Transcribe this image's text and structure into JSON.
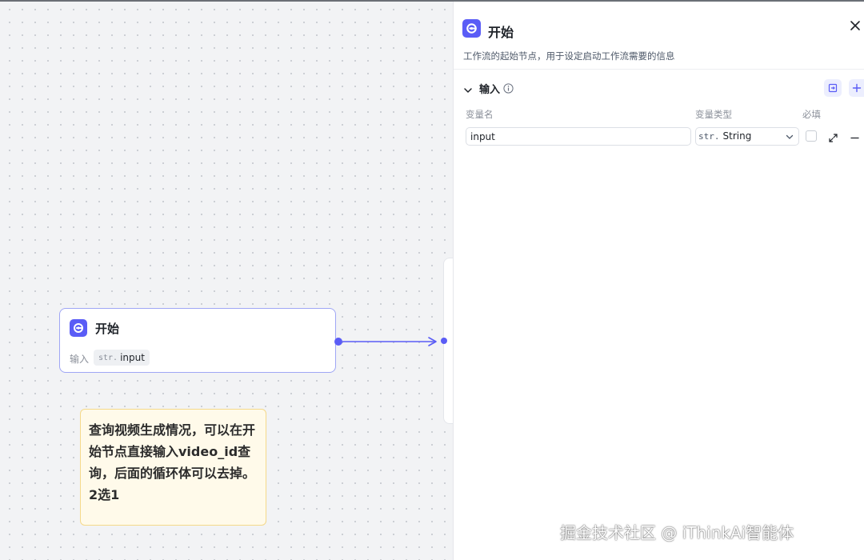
{
  "canvas": {
    "start_node": {
      "title": "开始",
      "input_label": "输入",
      "input_var": {
        "type": "str.",
        "name": "input"
      }
    },
    "note": {
      "text": "查询视频生成情况，可以在开始节点直接输入video_id查询，后面的循环体可以去掉。2选1"
    }
  },
  "panel": {
    "title": "开始",
    "description": "工作流的起始节点，用于设定启动工作流需要的信息",
    "section": {
      "title": "输入",
      "columns": {
        "name": "变量名",
        "type": "变量类型",
        "required": "必填"
      },
      "rows": [
        {
          "name": "input",
          "type_prefix": "str.",
          "type": "String",
          "required": false
        }
      ]
    }
  },
  "watermark": "掘金技术社区 @ iThinkAi智能体",
  "colors": {
    "accent": "#5a5cf6",
    "node_border": "#9fa6f5",
    "note_bg": "#fffaea",
    "note_border": "#f5d98a"
  }
}
